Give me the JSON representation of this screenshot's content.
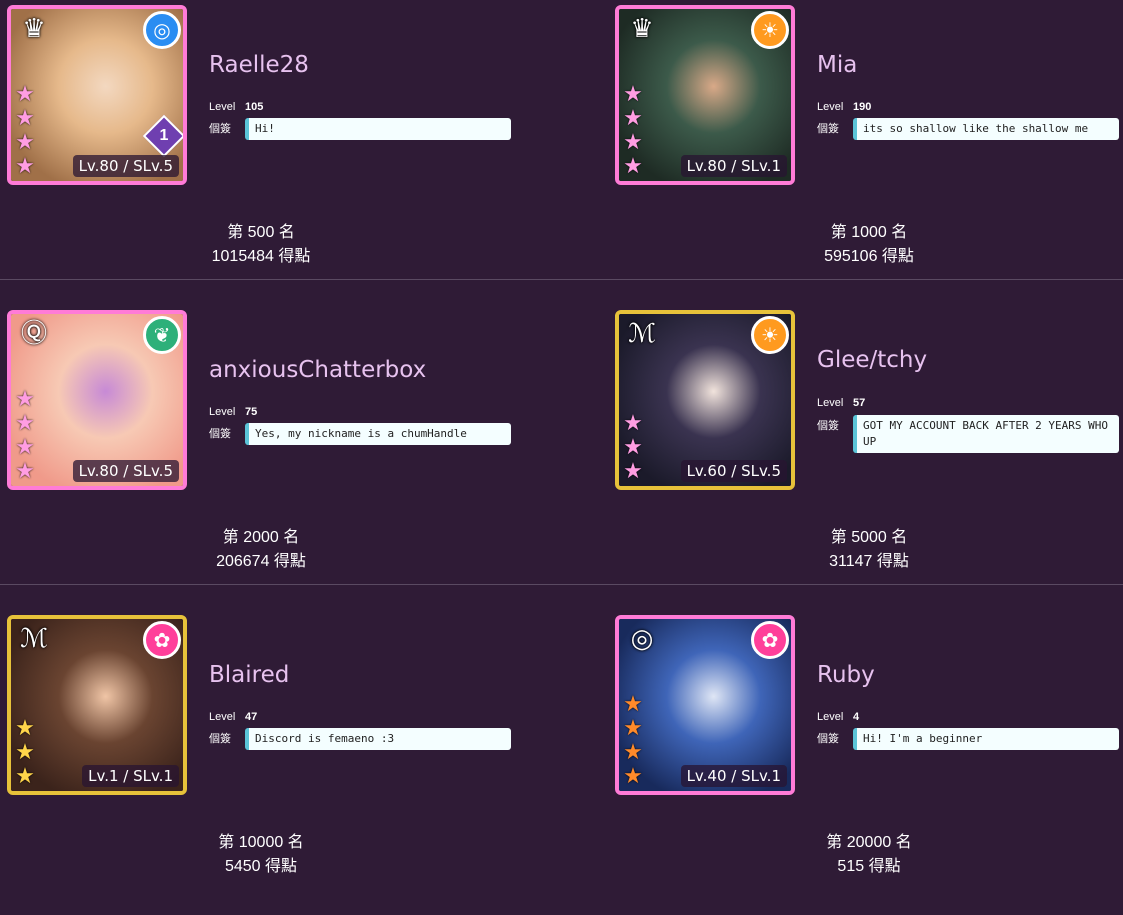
{
  "labels": {
    "level": "Level",
    "signature": "個簽"
  },
  "entries": [
    {
      "name": "Raelle28",
      "level": "105",
      "signature": "Hi!",
      "rank": "第 500 名",
      "points": "1015484 得點",
      "card": {
        "level_text": "Lv.80 / SLv.5",
        "band_icon": "crown-icon",
        "band_glyph": "♛",
        "attr_icon": "cool-icon",
        "attr_glyph": "◎",
        "attr_color": "#2a8df2",
        "stars": [
          "★",
          "★",
          "★",
          "★"
        ],
        "star_color": "#ff9de2",
        "frame_color": "#ff7bd7",
        "art_colors": [
          "#a07048",
          "#e6b98b",
          "#f3d8c0"
        ],
        "badge_text": "1"
      }
    },
    {
      "name": "Mia",
      "level": "190",
      "signature": "its so shallow like the shallow me",
      "rank": "第 1000 名",
      "points": "595106 得點",
      "card": {
        "level_text": "Lv.80 / SLv.1",
        "band_icon": "crown-icon",
        "band_glyph": "♛",
        "attr_icon": "happy-icon",
        "attr_glyph": "☀",
        "attr_color": "#ff9a1f",
        "stars": [
          "★",
          "★",
          "★",
          "★"
        ],
        "star_color": "#ff9de2",
        "frame_color": "#ff7bd7",
        "art_colors": [
          "#1e2b24",
          "#3c5a4a",
          "#d9a988"
        ]
      }
    },
    {
      "name": "anxiousChatterbox",
      "level": "75",
      "signature": "Yes, my nickname is a chumHandle",
      "rank": "第 2000 名",
      "points": "206674 得點",
      "card": {
        "level_text": "Lv.80 / SLv.5",
        "band_icon": "band-logo-icon",
        "band_glyph": "Ⓠ",
        "attr_icon": "pure-icon",
        "attr_glyph": "❦",
        "attr_color": "#2db07a",
        "stars": [
          "★",
          "★",
          "★",
          "★"
        ],
        "star_color": "#ff9de2",
        "frame_color": "#ff7bd7",
        "art_colors": [
          "#f09a8a",
          "#f7c9b4",
          "#c78ad6"
        ]
      }
    },
    {
      "name": "Glee/tchy",
      "level": "57",
      "signature": "GOT MY ACCOUNT BACK AFTER 2 YEARS WHO UP",
      "rank": "第 5000 名",
      "points": "31147 得點",
      "card": {
        "level_text": "Lv.60 / SLv.5",
        "band_icon": "band-logo-icon",
        "band_glyph": "ℳ",
        "attr_icon": "happy-icon",
        "attr_glyph": "☀",
        "attr_color": "#ff9a1f",
        "stars": [
          "★",
          "★",
          "★"
        ],
        "star_color": "#ff9de2",
        "frame_color": "#e7c23a",
        "art_colors": [
          "#1b1a2a",
          "#3a3350",
          "#f1e3dc"
        ]
      }
    },
    {
      "name": "Blaired",
      "level": "47",
      "signature": "Discord is femaeno :3",
      "rank": "第 10000 名",
      "points": "5450 得點",
      "card": {
        "level_text": "Lv.1 / SLv.1",
        "band_icon": "band-logo-icon",
        "band_glyph": "ℳ",
        "attr_icon": "powerful-icon",
        "attr_glyph": "✿",
        "attr_color": "#ff3f9a",
        "stars": [
          "★",
          "★",
          "★"
        ],
        "star_color": "#ffd54a",
        "frame_color": "#e7c23a",
        "art_colors": [
          "#3b231b",
          "#6a4431",
          "#f0c5a6"
        ]
      }
    },
    {
      "name": "Ruby",
      "level": "4",
      "signature": "Hi! I'm a beginner",
      "rank": "第 20000 名",
      "points": "515 得點",
      "card": {
        "level_text": "Lv.40 / SLv.1",
        "band_icon": "band-logo-icon",
        "band_glyph": "◎",
        "attr_icon": "powerful-icon",
        "attr_glyph": "✿",
        "attr_color": "#ff3f9a",
        "stars": [
          "★",
          "★",
          "★",
          "★"
        ],
        "star_color": "#ff8a2a",
        "frame_color": "#ff7bd7",
        "art_colors": [
          "#182a5c",
          "#3f65b8",
          "#dfe6f5"
        ]
      }
    }
  ]
}
